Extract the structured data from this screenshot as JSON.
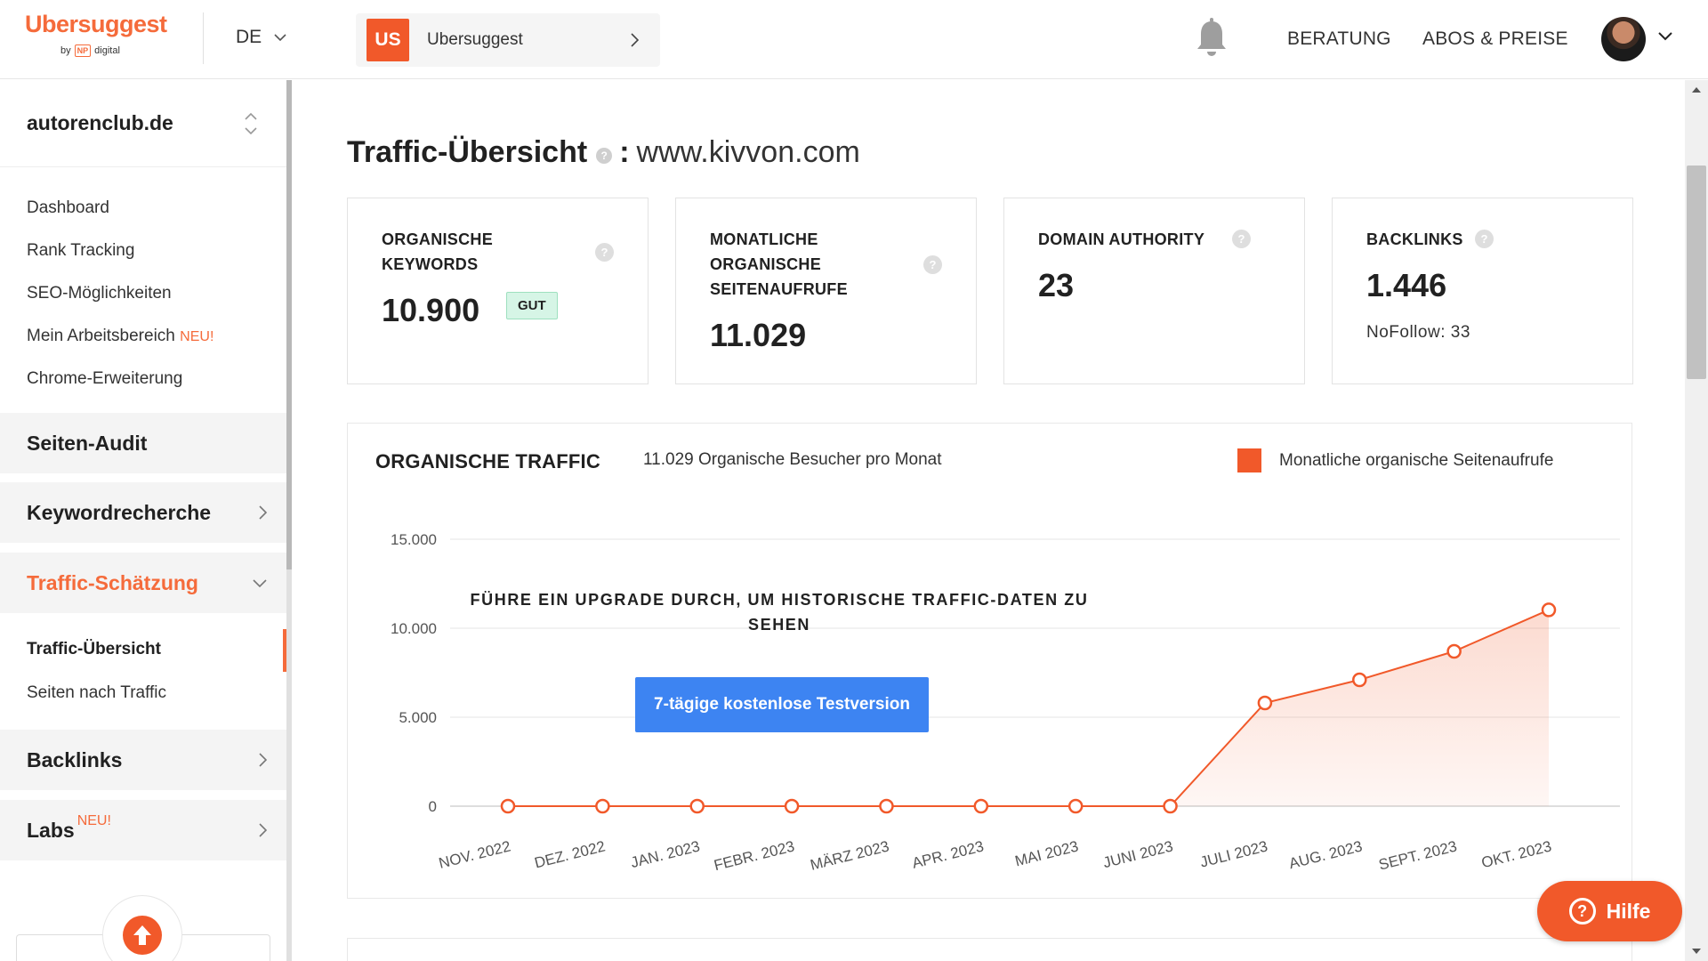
{
  "header": {
    "logo_text": "Ubersuggest",
    "logo_by": "by",
    "logo_np": "NP",
    "logo_digital": "digital",
    "language": "DE",
    "project_badge": "US",
    "project_name": "Ubersuggest",
    "nav_consulting": "BERATUNG",
    "nav_pricing": "ABOS & PREISE",
    "icons": [
      "bell-icon",
      "chevron-down-icon",
      "chevron-right-icon"
    ]
  },
  "sidebar": {
    "site": "autorenclub.de",
    "links": [
      {
        "label": "Dashboard"
      },
      {
        "label": "Rank Tracking"
      },
      {
        "label": "SEO-Möglichkeiten"
      },
      {
        "label": "Mein Arbeitsbereich",
        "badge": "NEU!"
      },
      {
        "label": "Chrome-Erweiterung"
      }
    ],
    "sections": {
      "audit": "Seiten-Audit",
      "keyword": "Keywordrecherche",
      "traffic": "Traffic-Schätzung",
      "backlinks": "Backlinks",
      "labs": "Labs",
      "labs_badge": "NEU!"
    },
    "traffic_sub": {
      "overview": "Traffic-Übersicht",
      "pages": "Seiten nach Traffic"
    }
  },
  "main": {
    "title": "Traffic-Übersicht",
    "colon": ":",
    "domain": "www.kivvon.com",
    "help_glyph": "?",
    "cards": [
      {
        "label_lines": [
          "ORGANISCHE",
          "KEYWORDS"
        ],
        "value": "10.900",
        "badge": "GUT"
      },
      {
        "label_lines": [
          "MONATLICHE",
          "ORGANISCHE",
          "SEITENAUFRUFE"
        ],
        "value": "11.029"
      },
      {
        "label_lines": [
          "DOMAIN AUTHORITY"
        ],
        "value": "23"
      },
      {
        "label_lines": [
          "BACKLINKS"
        ],
        "value": "1.446",
        "extra": "NoFollow: 33"
      }
    ]
  },
  "chart": {
    "title": "ORGANISCHE TRAFFIC",
    "subtitle": "11.029 Organische Besucher pro Monat",
    "legend": "Monatliche organische Seitenaufrufe",
    "upgrade_line1": "FÜHRE EIN UPGRADE DURCH, UM HISTORISCHE TRAFFIC-DATEN ZU",
    "upgrade_line2": "SEHEN",
    "trial_button": "7-tägige kostenlose Testversion",
    "accent": "#f1592a"
  },
  "chart_data": {
    "type": "line",
    "categories": [
      "NOV. 2022",
      "DEZ. 2022",
      "JAN. 2023",
      "FEBR. 2023",
      "MÄRZ 2023",
      "APR. 2023",
      "MAI 2023",
      "JUNI 2023",
      "JULI 2023",
      "AUG. 2023",
      "SEPT. 2023",
      "OKT. 2023"
    ],
    "series": [
      {
        "name": "Monatliche organische Seitenaufrufe",
        "values": [
          0,
          0,
          0,
          0,
          0,
          0,
          0,
          0,
          5800,
          7100,
          8700,
          11029
        ]
      }
    ],
    "yticks": [
      "0",
      "5.000",
      "10.000",
      "15.000"
    ],
    "ylim": [
      0,
      15000
    ],
    "grid": true,
    "legend_position": "top-right"
  },
  "help_button": "Hilfe"
}
